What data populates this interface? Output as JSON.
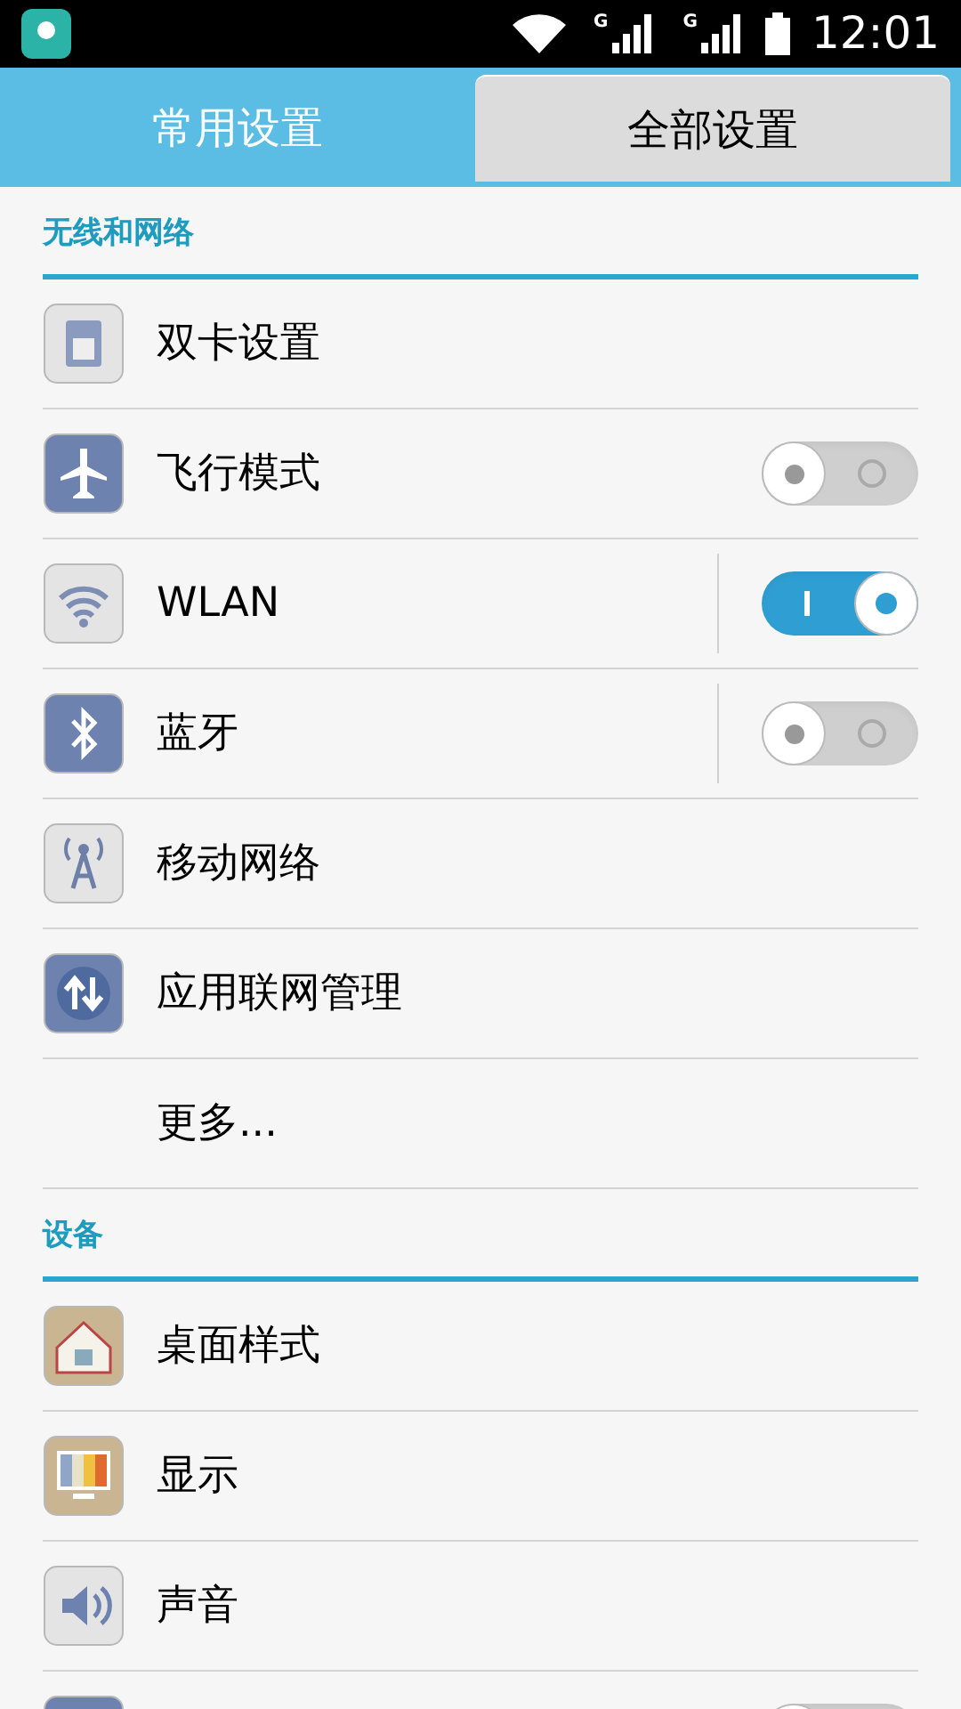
{
  "status_bar": {
    "network_labels": [
      "G",
      "G"
    ],
    "time": "12:01"
  },
  "tabs": [
    {
      "label": "常用设置",
      "selected": false
    },
    {
      "label": "全部设置",
      "selected": true
    }
  ],
  "sections": [
    {
      "title": "无线和网络",
      "items": [
        {
          "kind": "link",
          "label": "双卡设置"
        },
        {
          "kind": "toggle",
          "label": "飞行模式",
          "on": false
        },
        {
          "kind": "split_toggle",
          "label": "WLAN",
          "on": true
        },
        {
          "kind": "split_toggle",
          "label": "蓝牙",
          "on": false
        },
        {
          "kind": "link",
          "label": "移动网络"
        },
        {
          "kind": "link",
          "label": "应用联网管理"
        },
        {
          "kind": "text",
          "label": "更多..."
        }
      ]
    },
    {
      "title": "设备",
      "items": [
        {
          "kind": "link",
          "label": "桌面样式"
        },
        {
          "kind": "link",
          "label": "显示"
        },
        {
          "kind": "link",
          "label": "声音"
        },
        {
          "kind": "toggle",
          "on": false
        }
      ]
    }
  ]
}
